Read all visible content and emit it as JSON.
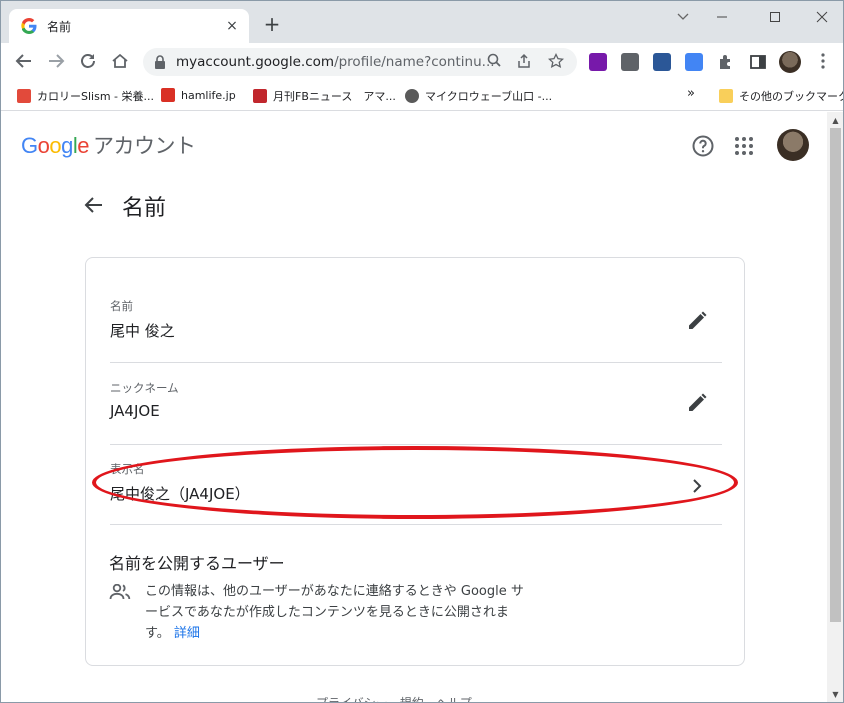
{
  "browser": {
    "tab": {
      "title": "名前",
      "close": "×"
    },
    "new_tab": "+",
    "url": "myaccount.google.com",
    "url_path": "/profile/name?continu...",
    "bookmarks": [
      {
        "label": "カロリーSlism - 栄養...",
        "color": "#e24a3b"
      },
      {
        "label": "hamlife.jp",
        "color": "#d93025"
      },
      {
        "label": "月刊FBニュース　アマ...",
        "color": "#c1272d"
      },
      {
        "label": "マイクロウェーブ山口 -...",
        "color": "#5a5a5a"
      }
    ],
    "bookmarks_overflow": "»",
    "other_bookmarks": "その他のブックマーク"
  },
  "header": {
    "logo_letters": [
      "G",
      "o",
      "o",
      "g",
      "l",
      "e"
    ],
    "account_label": "アカウント"
  },
  "page": {
    "title": "名前"
  },
  "fields": [
    {
      "label": "名前",
      "value": "尾中 俊之"
    },
    {
      "label": "ニックネーム",
      "value": "JA4JOE"
    },
    {
      "label": "表示名",
      "value": "尾中俊之（JA4JOE）"
    }
  ],
  "public": {
    "title": "名前を公開するユーザー",
    "description": "この情報は、他のユーザーがあなたに連絡するときや Google サービスであなたが作成したコンテンツを見るときに公開されます。",
    "link": "詳細"
  },
  "footer": {
    "text": "プライバシー　規約　ヘルプ"
  },
  "colors": {
    "highlight": "#e0161c",
    "link": "#1a73e8"
  }
}
